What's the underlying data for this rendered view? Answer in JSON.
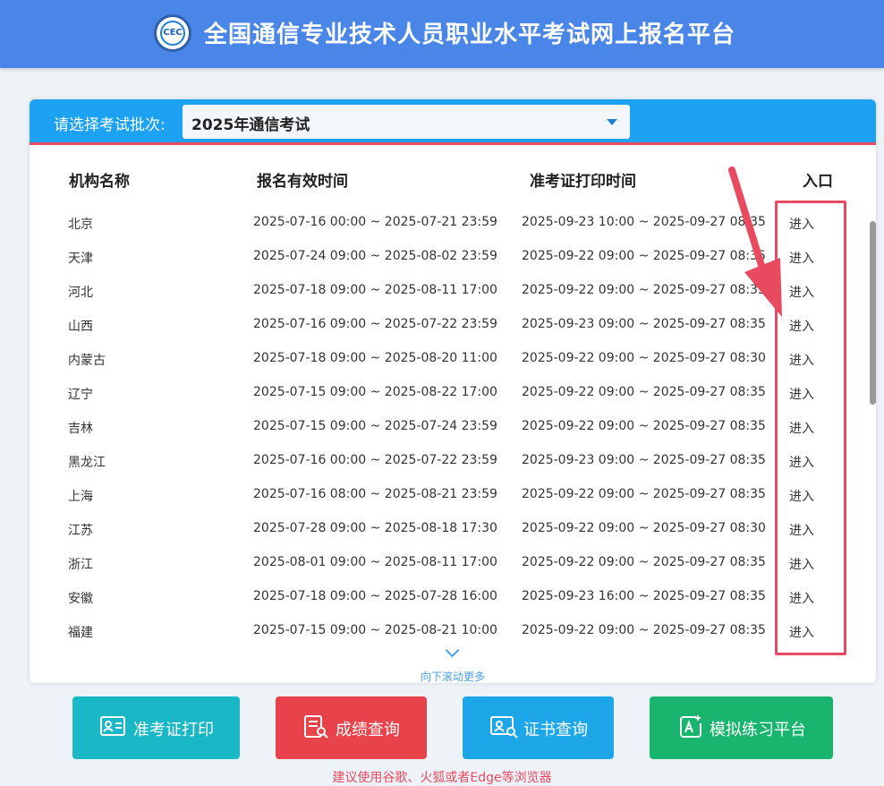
{
  "header": {
    "title": "全国通信专业技术人员职业水平考试网上报名平台",
    "logo_text": "CEC"
  },
  "batch": {
    "label": "请选择考试批次:",
    "selected": "2025年通信考试"
  },
  "table": {
    "headers": {
      "org": "机构名称",
      "reg": "报名有效时间",
      "print": "准考证打印时间",
      "entry": "入口"
    },
    "rows": [
      {
        "org": "北京",
        "reg": "2025-07-16 00:00 ~ 2025-07-21 23:59",
        "print": "2025-09-23 10:00 ~ 2025-09-27 08:35",
        "entry": "进入"
      },
      {
        "org": "天津",
        "reg": "2025-07-24 09:00 ~ 2025-08-02 23:59",
        "print": "2025-09-22 09:00 ~ 2025-09-27 08:35",
        "entry": "进入"
      },
      {
        "org": "河北",
        "reg": "2025-07-18 09:00 ~ 2025-08-11 17:00",
        "print": "2025-09-22 09:00 ~ 2025-09-27 08:35",
        "entry": "进入"
      },
      {
        "org": "山西",
        "reg": "2025-07-16 09:00 ~ 2025-07-22 23:59",
        "print": "2025-09-23 09:00 ~ 2025-09-27 08:35",
        "entry": "进入"
      },
      {
        "org": "内蒙古",
        "reg": "2025-07-18 09:00 ~ 2025-08-20 11:00",
        "print": "2025-09-22 09:00 ~ 2025-09-27 08:30",
        "entry": "进入"
      },
      {
        "org": "辽宁",
        "reg": "2025-07-15 09:00 ~ 2025-08-22 17:00",
        "print": "2025-09-22 09:00 ~ 2025-09-27 08:35",
        "entry": "进入"
      },
      {
        "org": "吉林",
        "reg": "2025-07-15 09:00 ~ 2025-07-24 23:59",
        "print": "2025-09-22 09:00 ~ 2025-09-27 08:35",
        "entry": "进入"
      },
      {
        "org": "黑龙江",
        "reg": "2025-07-16 00:00 ~ 2025-07-22 23:59",
        "print": "2025-09-23 09:00 ~ 2025-09-27 08:35",
        "entry": "进入"
      },
      {
        "org": "上海",
        "reg": "2025-07-16 08:00 ~ 2025-08-21 23:59",
        "print": "2025-09-22 09:00 ~ 2025-09-27 08:35",
        "entry": "进入"
      },
      {
        "org": "江苏",
        "reg": "2025-07-28 09:00 ~ 2025-08-18 17:30",
        "print": "2025-09-22 09:00 ~ 2025-09-27 08:30",
        "entry": "进入"
      },
      {
        "org": "浙江",
        "reg": "2025-08-01 09:00 ~ 2025-08-11 17:00",
        "print": "2025-09-22 09:00 ~ 2025-09-27 08:35",
        "entry": "进入"
      },
      {
        "org": "安徽",
        "reg": "2025-07-18 09:00 ~ 2025-07-28 16:00",
        "print": "2025-09-23 16:00 ~ 2025-09-27 08:35",
        "entry": "进入"
      },
      {
        "org": "福建",
        "reg": "2025-07-15 09:00 ~ 2025-08-21 10:00",
        "print": "2025-09-22 09:00 ~ 2025-09-27 08:35",
        "entry": "进入"
      }
    ]
  },
  "scroll_hint": "向下滚动更多",
  "buttons": [
    {
      "label": "准考证打印",
      "icon": "id-card-icon"
    },
    {
      "label": "成绩查询",
      "icon": "document-search-icon"
    },
    {
      "label": "证书查询",
      "icon": "certificate-search-icon"
    },
    {
      "label": "模拟练习平台",
      "icon": "edit-icon"
    }
  ],
  "footer_note": "建议使用谷歌、火狐或者Edge等浏览器",
  "colors": {
    "header": "#4a86e8",
    "panel_bar": "#1da1f2",
    "accent_red": "#e84a5f",
    "btn1": "#1ab8c7",
    "btn2": "#e8434a",
    "btn3": "#1ea7e8",
    "btn4": "#19b46e"
  }
}
